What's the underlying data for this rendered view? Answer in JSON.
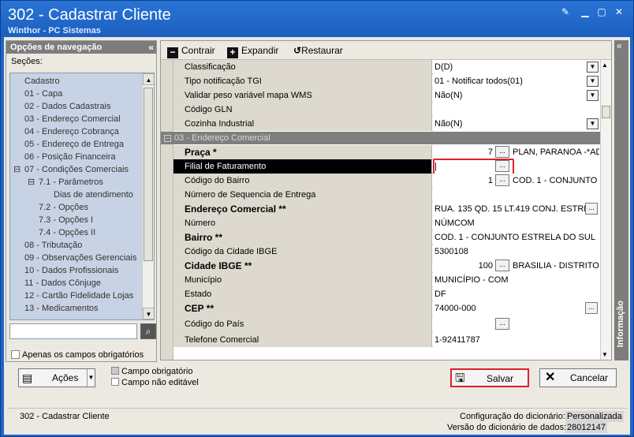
{
  "window": {
    "title": "302 - Cadastrar Cliente",
    "subtitle": "Winthor - PC Sistemas"
  },
  "nav": {
    "header": "Opções de navegação",
    "secoes_label": "Seções:",
    "items": [
      "Cadastro",
      "01 - Capa",
      "02 - Dados Cadastrais",
      "03 - Endereço Comercial",
      "04 - Endereço Cobrança",
      "05 - Endereço de Entrega",
      "06 - Posição Financeira",
      "07 - Condições Comerciais",
      "7.1 - Parâmetros",
      "Dias de atendimento",
      "7.2 - Opções",
      "7.3 - Opções I",
      "7.4 - Opções II",
      "08 - Tributação",
      "09 - Observações Gerenciais",
      "10 - Dados Profissionais",
      "11 - Dados Cônjuge",
      "12 - Cartão Fidelidade Lojas",
      "13 - Medicamentos"
    ],
    "only_required_label": "Apenas os campos obrigatórios"
  },
  "toolbar": {
    "contrair": "Contrair",
    "expandir": "Expandir",
    "restaurar": "Restaurar"
  },
  "grid": {
    "top_rows": [
      {
        "label": "Classificação",
        "value": "D(D)"
      },
      {
        "label": "Tipo notificação TGI",
        "value": "01 - Notificar todos(01)"
      },
      {
        "label": "Validar peso variável mapa WMS",
        "value": "Não(N)"
      },
      {
        "label": "Código GLN",
        "value": ""
      },
      {
        "label": "Cozinha Industrial",
        "value": "Não(N)"
      }
    ],
    "group_label": "03 - Endereço Comercial",
    "praca": {
      "label": "Praça *",
      "num": "7",
      "desc": "PLAN, PARANOA -*AD"
    },
    "filial": {
      "label": "Filial de Faturamento",
      "value": "|"
    },
    "bairro_codigo": {
      "label": "Código do Bairro",
      "num": "1",
      "desc": "COD. 1 - CONJUNTO E"
    },
    "seq_entrega": {
      "label": "Número de Sequencia de Entrega",
      "value": ""
    },
    "endereco": {
      "label": "Endereço Comercial **",
      "value": "RUA. 135 QD. 15 LT.419 CONJ. ESTREL"
    },
    "numero": {
      "label": "Número",
      "value": "NÚMCOM"
    },
    "bairro": {
      "label": "Bairro **",
      "value": "COD. 1 - CONJUNTO ESTRELA DO SUL"
    },
    "cod_cidade_ibge": {
      "label": "Código da Cidade IBGE",
      "value": "5300108"
    },
    "cidade_ibge": {
      "label": "Cidade IBGE **",
      "num": "100",
      "desc": "BRASILIA - DISTRITO"
    },
    "municipio": {
      "label": "Município",
      "value": "MUNICÍPIO - COM"
    },
    "estado": {
      "label": "Estado",
      "value": "DF"
    },
    "cep": {
      "label": "CEP **",
      "value": "74000-000"
    },
    "cod_pais": {
      "label": "Código do País",
      "value": ""
    },
    "telefone": {
      "label": "Telefone Comercial",
      "value": "1-92411787"
    }
  },
  "info_panel_label": "Informação",
  "bottom": {
    "acoes": "Ações",
    "legend_required": "Campo obrigatório",
    "legend_not_editable": "Campo não editável",
    "salvar": "Salvar",
    "cancelar": "Cancelar"
  },
  "status": {
    "left": "302 - Cadastrar Cliente",
    "config_label": "Configuração do dicionário:",
    "config_value": "Personalizada",
    "version_label": "Versão do dicionário de dados:",
    "version_value": "28012147"
  },
  "colors": {
    "title_bar": "#1f66c8",
    "highlight_border": "#e0202c",
    "selected_row": "#000000",
    "tree_background": "#c7d3e4"
  }
}
